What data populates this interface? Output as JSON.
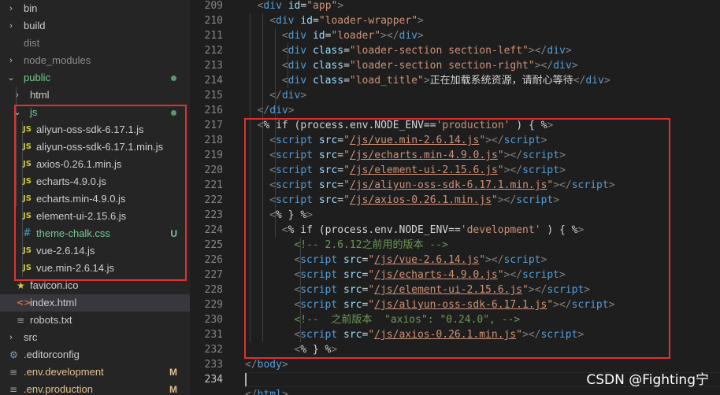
{
  "sidebar": {
    "rows": [
      {
        "indent": 0,
        "chevron": "›",
        "icon": "",
        "label": "bin",
        "color": "#cccccc"
      },
      {
        "indent": 0,
        "chevron": "›",
        "icon": "",
        "label": "build",
        "color": "#cccccc"
      },
      {
        "indent": 0,
        "chevron": "",
        "icon": "",
        "label": "dist",
        "color": "#8c8c8c"
      },
      {
        "indent": 0,
        "chevron": "›",
        "icon": "",
        "label": "node_modules",
        "color": "#8c8c8c"
      },
      {
        "indent": 0,
        "chevron": "⌄",
        "icon": "",
        "label": "public",
        "color": "#73c991",
        "dot": true
      },
      {
        "indent": 1,
        "chevron": "›",
        "icon": "",
        "label": "html",
        "color": "#cccccc"
      },
      {
        "indent": 1,
        "chevron": "⌄",
        "icon": "",
        "label": "js",
        "color": "#73c991",
        "dot": true
      },
      {
        "indent": 2,
        "chevron": "",
        "icon": "JS",
        "icon_type": "js",
        "label": "aliyun-oss-sdk-6.17.1.js",
        "color": "#cccccc"
      },
      {
        "indent": 2,
        "chevron": "",
        "icon": "JS",
        "icon_type": "js",
        "label": "aliyun-oss-sdk-6.17.1.min.js",
        "color": "#cccccc"
      },
      {
        "indent": 2,
        "chevron": "",
        "icon": "JS",
        "icon_type": "js",
        "label": "axios-0.26.1.min.js",
        "color": "#cccccc"
      },
      {
        "indent": 2,
        "chevron": "",
        "icon": "JS",
        "icon_type": "js",
        "label": "echarts-4.9.0.js",
        "color": "#cccccc"
      },
      {
        "indent": 2,
        "chevron": "",
        "icon": "JS",
        "icon_type": "js",
        "label": "echarts.min-4.9.0.js",
        "color": "#cccccc"
      },
      {
        "indent": 2,
        "chevron": "",
        "icon": "JS",
        "icon_type": "js",
        "label": "element-ui-2.15.6.js",
        "color": "#cccccc"
      },
      {
        "indent": 2,
        "chevron": "",
        "icon": "#",
        "icon_type": "css",
        "label": "theme-chalk.css",
        "color": "#73c991",
        "badge": "U"
      },
      {
        "indent": 2,
        "chevron": "",
        "icon": "JS",
        "icon_type": "js",
        "label": "vue-2.6.14.js",
        "color": "#cccccc"
      },
      {
        "indent": 2,
        "chevron": "",
        "icon": "JS",
        "icon_type": "js",
        "label": "vue.min-2.6.14.js",
        "color": "#cccccc"
      },
      {
        "indent": 1,
        "chevron": "",
        "icon": "★",
        "icon_type": "star",
        "label": "favicon.ico",
        "color": "#cccccc"
      },
      {
        "indent": 1,
        "chevron": "",
        "icon": "<>",
        "icon_type": "html",
        "label": "index.html",
        "color": "#cccccc",
        "selected": true
      },
      {
        "indent": 1,
        "chevron": "",
        "icon": "≡",
        "icon_type": "txt",
        "label": "robots.txt",
        "color": "#cccccc"
      },
      {
        "indent": 0,
        "chevron": "›",
        "icon": "",
        "label": "src",
        "color": "#cccccc"
      },
      {
        "indent": 0,
        "chevron": "",
        "icon": "⚙",
        "icon_type": "gear",
        "label": ".editorconfig",
        "color": "#cccccc"
      },
      {
        "indent": 0,
        "chevron": "",
        "icon": "≡",
        "icon_type": "env",
        "label": ".env.development",
        "color": "#e2c08d",
        "badge": "M"
      },
      {
        "indent": 0,
        "chevron": "",
        "icon": "≡",
        "icon_type": "env",
        "label": ".env.production",
        "color": "#e2c08d",
        "badge": "M"
      }
    ]
  },
  "editor": {
    "lines": [
      {
        "n": "209",
        "indent": 1,
        "seg": [
          [
            "b",
            "<"
          ],
          [
            "t",
            "div"
          ],
          [
            "x",
            " "
          ],
          [
            "a",
            "id"
          ],
          [
            "x",
            "="
          ],
          [
            "s",
            "\"app\""
          ],
          [
            "b",
            ">"
          ]
        ]
      },
      {
        "n": "210",
        "indent": 2,
        "seg": [
          [
            "b",
            "<"
          ],
          [
            "t",
            "div"
          ],
          [
            "x",
            " "
          ],
          [
            "a",
            "id"
          ],
          [
            "x",
            "="
          ],
          [
            "s",
            "\"loader-wrapper\""
          ],
          [
            "b",
            ">"
          ]
        ]
      },
      {
        "n": "211",
        "indent": 3,
        "seg": [
          [
            "b",
            "<"
          ],
          [
            "t",
            "div"
          ],
          [
            "x",
            " "
          ],
          [
            "a",
            "id"
          ],
          [
            "x",
            "="
          ],
          [
            "s",
            "\"loader\""
          ],
          [
            "b",
            "></"
          ],
          [
            "t",
            "div"
          ],
          [
            "b",
            ">"
          ]
        ]
      },
      {
        "n": "212",
        "indent": 3,
        "seg": [
          [
            "b",
            "<"
          ],
          [
            "t",
            "div"
          ],
          [
            "x",
            " "
          ],
          [
            "a",
            "class"
          ],
          [
            "x",
            "="
          ],
          [
            "s",
            "\"loader-section section-left\""
          ],
          [
            "b",
            "></"
          ],
          [
            "t",
            "div"
          ],
          [
            "b",
            ">"
          ]
        ]
      },
      {
        "n": "213",
        "indent": 3,
        "seg": [
          [
            "b",
            "<"
          ],
          [
            "t",
            "div"
          ],
          [
            "x",
            " "
          ],
          [
            "a",
            "class"
          ],
          [
            "x",
            "="
          ],
          [
            "s",
            "\"loader-section section-right\""
          ],
          [
            "b",
            "></"
          ],
          [
            "t",
            "div"
          ],
          [
            "b",
            ">"
          ]
        ]
      },
      {
        "n": "214",
        "indent": 3,
        "seg": [
          [
            "b",
            "<"
          ],
          [
            "t",
            "div"
          ],
          [
            "x",
            " "
          ],
          [
            "a",
            "class"
          ],
          [
            "x",
            "="
          ],
          [
            "s",
            "\"load_title\""
          ],
          [
            "b",
            ">"
          ],
          [
            "x",
            "正在加载系统资源，请耐心等待"
          ],
          [
            "b",
            "</"
          ],
          [
            "t",
            "div"
          ],
          [
            "b",
            ">"
          ]
        ]
      },
      {
        "n": "215",
        "indent": 2,
        "seg": [
          [
            "b",
            "</"
          ],
          [
            "t",
            "div"
          ],
          [
            "b",
            ">"
          ]
        ]
      },
      {
        "n": "216",
        "indent": 1,
        "seg": [
          [
            "b",
            "</"
          ],
          [
            "t",
            "div"
          ],
          [
            "b",
            ">"
          ]
        ]
      },
      {
        "n": "217",
        "indent": 1,
        "seg": [
          [
            "b",
            "<"
          ],
          [
            "x",
            "% if (process.env.NODE_ENV=="
          ],
          [
            "s",
            "'production'"
          ],
          [
            "x",
            " ) { %"
          ],
          [
            "b",
            ">"
          ]
        ]
      },
      {
        "n": "218",
        "indent": 2,
        "seg": [
          [
            "b",
            "<"
          ],
          [
            "t",
            "script"
          ],
          [
            "x",
            " "
          ],
          [
            "a",
            "src"
          ],
          [
            "x",
            "="
          ],
          [
            "s",
            "\""
          ],
          [
            "su",
            "/js/vue.min-2.6.14.js"
          ],
          [
            "s",
            "\""
          ],
          [
            "b",
            "></"
          ],
          [
            "t",
            "script"
          ],
          [
            "b",
            ">"
          ]
        ]
      },
      {
        "n": "219",
        "indent": 2,
        "seg": [
          [
            "b",
            "<"
          ],
          [
            "t",
            "script"
          ],
          [
            "x",
            " "
          ],
          [
            "a",
            "src"
          ],
          [
            "x",
            "="
          ],
          [
            "s",
            "\""
          ],
          [
            "su",
            "/js/echarts.min-4.9.0.js"
          ],
          [
            "s",
            "\""
          ],
          [
            "b",
            "></"
          ],
          [
            "t",
            "script"
          ],
          [
            "b",
            ">"
          ]
        ]
      },
      {
        "n": "220",
        "indent": 2,
        "seg": [
          [
            "b",
            "<"
          ],
          [
            "t",
            "script"
          ],
          [
            "x",
            " "
          ],
          [
            "a",
            "src"
          ],
          [
            "x",
            "="
          ],
          [
            "s",
            "\""
          ],
          [
            "su",
            "/js/element-ui-2.15.6.js"
          ],
          [
            "s",
            "\""
          ],
          [
            "b",
            "></"
          ],
          [
            "t",
            "script"
          ],
          [
            "b",
            ">"
          ]
        ]
      },
      {
        "n": "221",
        "indent": 2,
        "seg": [
          [
            "b",
            "<"
          ],
          [
            "t",
            "script"
          ],
          [
            "x",
            " "
          ],
          [
            "a",
            "src"
          ],
          [
            "x",
            "="
          ],
          [
            "s",
            "\""
          ],
          [
            "su",
            "/js/aliyun-oss-sdk-6.17.1.min.js"
          ],
          [
            "s",
            "\""
          ],
          [
            "b",
            "></"
          ],
          [
            "t",
            "script"
          ],
          [
            "b",
            ">"
          ]
        ]
      },
      {
        "n": "222",
        "indent": 2,
        "seg": [
          [
            "b",
            "<"
          ],
          [
            "t",
            "script"
          ],
          [
            "x",
            " "
          ],
          [
            "a",
            "src"
          ],
          [
            "x",
            "="
          ],
          [
            "s",
            "\""
          ],
          [
            "su",
            "/js/axios-0.26.1.min.js"
          ],
          [
            "s",
            "\""
          ],
          [
            "b",
            "></"
          ],
          [
            "t",
            "script"
          ],
          [
            "b",
            ">"
          ]
        ]
      },
      {
        "n": "223",
        "indent": 2,
        "seg": [
          [
            "b",
            "<"
          ],
          [
            "x",
            "% } %"
          ],
          [
            "b",
            ">"
          ]
        ]
      },
      {
        "n": "224",
        "indent": 3,
        "seg": [
          [
            "b",
            "<"
          ],
          [
            "x",
            "% if (process.env.NODE_ENV=="
          ],
          [
            "s",
            "'development'"
          ],
          [
            "x",
            " ) { %"
          ],
          [
            "b",
            ">"
          ]
        ]
      },
      {
        "n": "225",
        "indent": 4,
        "seg": [
          [
            "c",
            "<!-- 2.6.12之前用的版本 -->"
          ]
        ]
      },
      {
        "n": "226",
        "indent": 4,
        "seg": [
          [
            "b",
            "<"
          ],
          [
            "t",
            "script"
          ],
          [
            "x",
            " "
          ],
          [
            "a",
            "src"
          ],
          [
            "x",
            "="
          ],
          [
            "s",
            "\""
          ],
          [
            "su",
            "/js/vue-2.6.14.js"
          ],
          [
            "s",
            "\""
          ],
          [
            "b",
            "></"
          ],
          [
            "t",
            "script"
          ],
          [
            "b",
            ">"
          ]
        ]
      },
      {
        "n": "227",
        "indent": 4,
        "seg": [
          [
            "b",
            "<"
          ],
          [
            "t",
            "script"
          ],
          [
            "x",
            " "
          ],
          [
            "a",
            "src"
          ],
          [
            "x",
            "="
          ],
          [
            "s",
            "\""
          ],
          [
            "su",
            "/js/echarts-4.9.0.js"
          ],
          [
            "s",
            "\""
          ],
          [
            "b",
            "></"
          ],
          [
            "t",
            "script"
          ],
          [
            "b",
            ">"
          ]
        ]
      },
      {
        "n": "228",
        "indent": 4,
        "seg": [
          [
            "b",
            "<"
          ],
          [
            "t",
            "script"
          ],
          [
            "x",
            " "
          ],
          [
            "a",
            "src"
          ],
          [
            "x",
            "="
          ],
          [
            "s",
            "\""
          ],
          [
            "su",
            "/js/element-ui-2.15.6.js"
          ],
          [
            "s",
            "\""
          ],
          [
            "b",
            "></"
          ],
          [
            "t",
            "script"
          ],
          [
            "b",
            ">"
          ]
        ]
      },
      {
        "n": "229",
        "indent": 4,
        "seg": [
          [
            "b",
            "<"
          ],
          [
            "t",
            "script"
          ],
          [
            "x",
            " "
          ],
          [
            "a",
            "src"
          ],
          [
            "x",
            "="
          ],
          [
            "s",
            "\""
          ],
          [
            "su",
            "/js/aliyun-oss-sdk-6.17.1.js"
          ],
          [
            "s",
            "\""
          ],
          [
            "b",
            "></"
          ],
          [
            "t",
            "script"
          ],
          [
            "b",
            ">"
          ]
        ]
      },
      {
        "n": "230",
        "indent": 4,
        "seg": [
          [
            "c",
            "<!--  之前版本  \"axios\": \"0.24.0\", -->"
          ]
        ]
      },
      {
        "n": "231",
        "indent": 4,
        "seg": [
          [
            "b",
            "<"
          ],
          [
            "t",
            "script"
          ],
          [
            "x",
            " "
          ],
          [
            "a",
            "src"
          ],
          [
            "x",
            "="
          ],
          [
            "s",
            "\""
          ],
          [
            "su",
            "/js/axios-0.26.1.min.js"
          ],
          [
            "s",
            "\""
          ],
          [
            "b",
            "></"
          ],
          [
            "t",
            "script"
          ],
          [
            "b",
            ">"
          ]
        ]
      },
      {
        "n": "232",
        "indent": 4,
        "seg": [
          [
            "b",
            "<"
          ],
          [
            "x",
            "% } %"
          ],
          [
            "b",
            ">"
          ]
        ]
      },
      {
        "n": "233",
        "indent": 0,
        "seg": [
          [
            "b",
            "</"
          ],
          [
            "t",
            "body"
          ],
          [
            "b",
            ">"
          ]
        ]
      },
      {
        "n": "234",
        "indent": 0,
        "seg": [],
        "current": true
      },
      {
        "n": "",
        "indent": 0,
        "seg": [
          [
            "b",
            "</"
          ],
          [
            "t",
            "html"
          ],
          [
            "b",
            ">"
          ]
        ]
      }
    ]
  },
  "watermark": "CSDN @Fighting宁"
}
